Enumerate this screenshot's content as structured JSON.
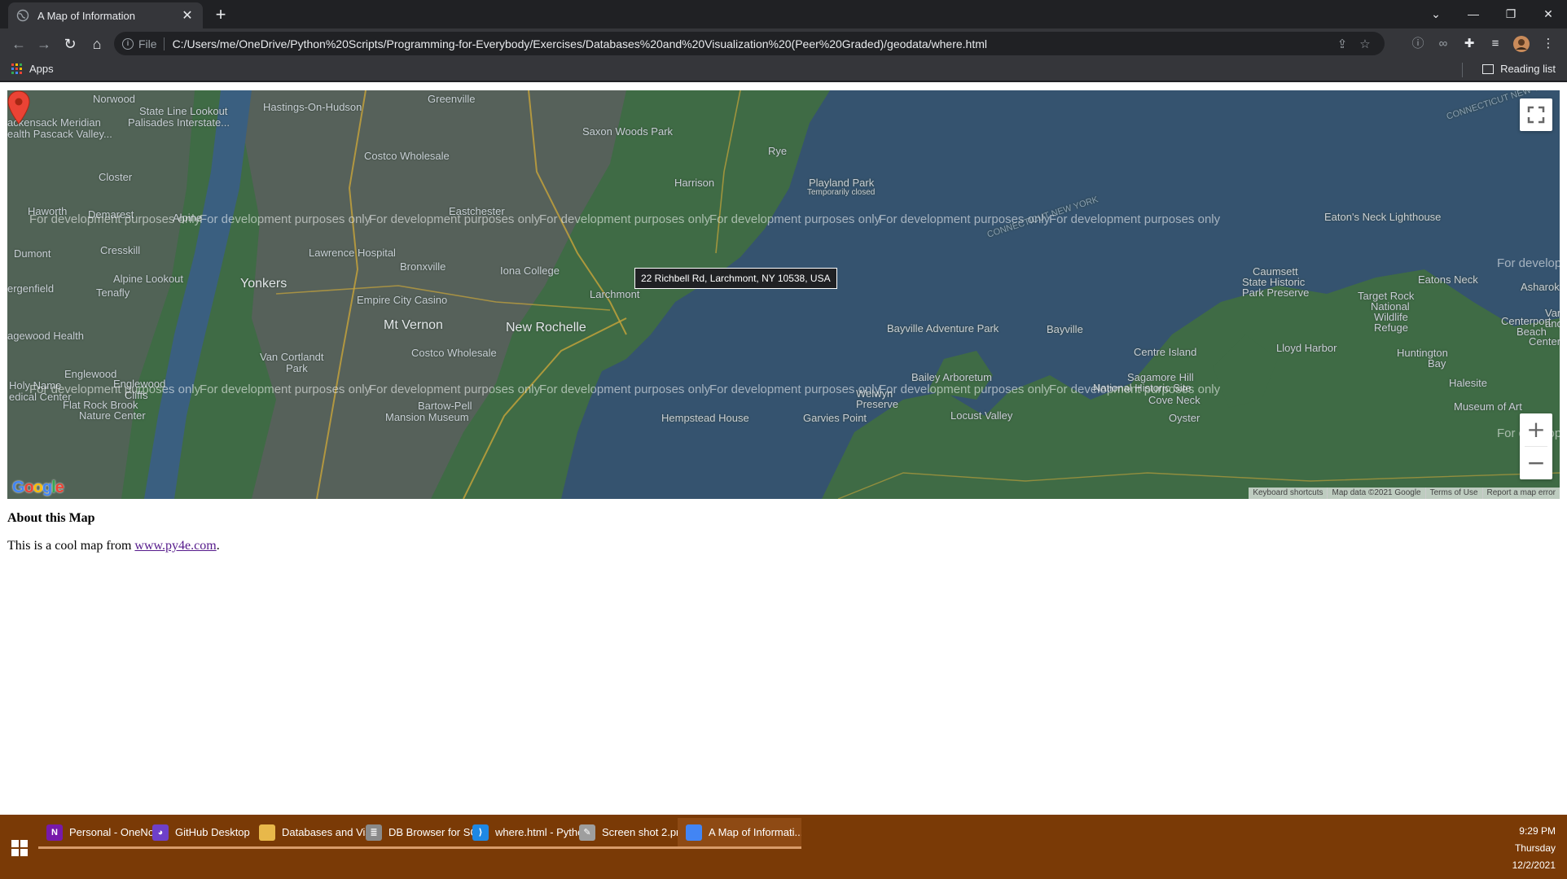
{
  "browser": {
    "tab": {
      "title": "A Map of Information",
      "close_icon": "close-icon"
    },
    "new_tab_label": "+",
    "window_controls": {
      "tab_search": "⌄",
      "minimize": "—",
      "restore": "❐",
      "close": "✕"
    },
    "nav": {
      "back": "←",
      "forward": "→",
      "reload": "↻",
      "home": "⌂"
    },
    "address": {
      "scheme": "File",
      "url": "C:/Users/me/OneDrive/Python%20Scripts/Programming-for-Everybody/Exercises/Databases%20and%20Visualization%20(Peer%20Graded)/geodata/where.html"
    },
    "bookmarks": {
      "apps_label": "Apps",
      "reading_list_label": "Reading list"
    }
  },
  "map": {
    "place_labels": [
      "Norwood",
      "State Line Lookout",
      "Palisades Interstate...",
      "Hastings-On-Hudson",
      "Greenville",
      "ackensack Meridian",
      "ealth Pascack Valley...",
      "Saxon Woods Park",
      "Costco Wholesale",
      "Rye",
      "Closter",
      "Harrison",
      "Playland Park",
      "Temporarily closed",
      "Haworth",
      "Eastchester",
      "Demarest",
      "Alpine",
      "Eaton's Neck Lighthouse",
      "Lawrence Hospital",
      "Bronxville",
      "Cresskill",
      "Dumont",
      "Iona College",
      "Alpine Lookout",
      "Yonkers",
      "Larchmont",
      "Caumsett",
      "State Historic",
      "Park Preserve",
      "Eatons Neck",
      "Asharok",
      "ergenfield",
      "Tenafly",
      "Empire City Casino",
      "Target Rock",
      "National",
      "Wildlife",
      "Refuge",
      "Mt Vernon",
      "New Rochelle",
      "Bayville Adventure Park",
      "Bayville",
      "Centerport",
      "Beach",
      "agewood Health",
      "Centre Island",
      "Lloyd Harbor",
      "Huntington",
      "Bay",
      "Van Cortlandt",
      "Park",
      "Costco Wholesale",
      "Englewood",
      "Bailey Arboretum",
      "Sagamore Hill",
      "National Historic Site",
      "Halesite",
      "Holy Name",
      "edical Center",
      "Englewood",
      "Cliffs",
      "Cove Neck",
      "Locust Valley",
      "Welwyn",
      "Preserve",
      "Nature Center",
      "Mansion Museum",
      "Bartow-Pell",
      "Hempstead House",
      "Garvies Point",
      "Oyster",
      "Museum of Art",
      "Flat Rock Brook",
      "Vand",
      "and H",
      "Centerport"
    ],
    "water_labels": [
      "CONNECTICUT NEW YORK",
      "CONNECTICUT NEW YORK"
    ],
    "watermark_text": "For development purposes only",
    "watermark_cut": "For develop",
    "marker_tooltip": "22 Richbell Rd, Larchmont, NY 10538, USA",
    "marker_color": "#ea4335",
    "zoom_in_label": "+",
    "zoom_out_label": "−",
    "attribution": [
      "Keyboard shortcuts",
      "Map data ©2021 Google",
      "Terms of Use",
      "Report a map error"
    ],
    "google_logo_letters": [
      "G",
      "o",
      "o",
      "g",
      "l",
      "e"
    ]
  },
  "page": {
    "about_title": "About this Map",
    "about_text_before": "This is a cool map from ",
    "about_link": "www.py4e.com",
    "about_text_after": "."
  },
  "taskbar": {
    "items": [
      {
        "label": "Personal - OneNot...",
        "icon": "onenote-icon",
        "glyph": "N",
        "color": "#7719aa"
      },
      {
        "label": "GitHub Desktop",
        "icon": "github-icon",
        "glyph": "◕",
        "color": "#6e40c9"
      },
      {
        "label": "Databases and Visu...",
        "icon": "folder-icon",
        "glyph": "",
        "color": "#e8b84a"
      },
      {
        "label": "DB Browser for SQL...",
        "icon": "database-icon",
        "glyph": "≣",
        "color": "#8a8a8a"
      },
      {
        "label": "where.html - Pytho...",
        "icon": "vscode-icon",
        "glyph": "⟩",
        "color": "#1e88e5"
      },
      {
        "label": "Screen shot 2.png -...",
        "icon": "paint-icon",
        "glyph": "✎",
        "color": "#9e9e9e"
      },
      {
        "label": "A Map of Informati...",
        "icon": "chrome-icon",
        "glyph": "",
        "color": "#4285f4"
      }
    ],
    "clock": {
      "time": "9:29 PM",
      "day": "Thursday",
      "date": "12/2/2021"
    }
  }
}
